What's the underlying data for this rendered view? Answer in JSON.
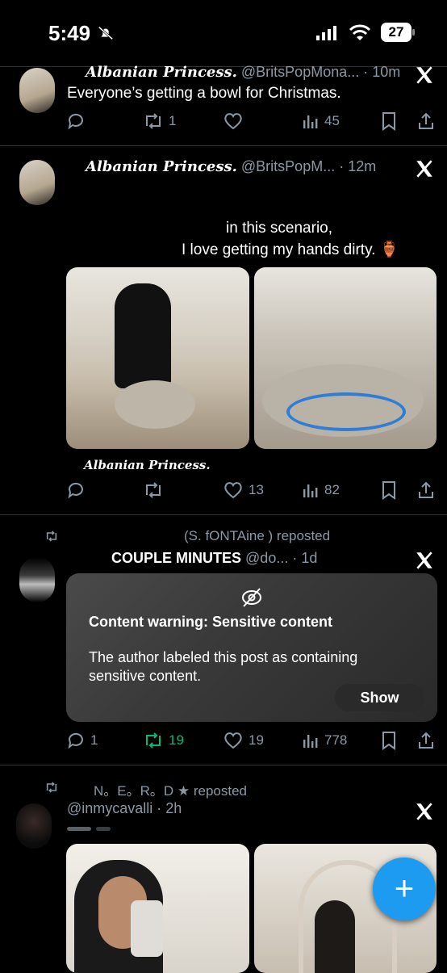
{
  "status_bar": {
    "time": "5:49",
    "battery": "27"
  },
  "tweets": [
    {
      "display_name": "Albanian   Princess.",
      "handle_time": "@BritsPopMona... · 10m",
      "text": "Everyone’s getting a bowl for Christmas.",
      "replies": "",
      "reposts": "1",
      "likes": "",
      "views": "45"
    },
    {
      "display_name": "Albanian   Princess.",
      "handle_time": "@BritsPopM... · 12m",
      "text_line1": "in this scenario,",
      "text_line2": "I love getting my hands dirty. 🏺",
      "image_caption": "Albanian   Princess.",
      "replies": "",
      "reposts": "",
      "likes": "13",
      "views": "82"
    },
    {
      "repost_by": "(S.  fONTAine ) reposted",
      "display_name": "COUPLE        MINUTES",
      "handle_time": "@do... · 1d",
      "warning_title": "Content warning: Sensitive content",
      "warning_body": "The author labeled this post as containing sensitive content.",
      "show_label": "Show",
      "replies": "1",
      "reposts": "19",
      "likes": "19",
      "views": "778"
    },
    {
      "repost_by": "N。E。R。D   ★ reposted",
      "handle_time": "@inmycavalli · 2h"
    }
  ],
  "fab_label": "+",
  "colors": {
    "background": "#000000",
    "accent": "#1d9bf0",
    "repost_active": "#00ba7c",
    "muted": "#8b98a5"
  }
}
